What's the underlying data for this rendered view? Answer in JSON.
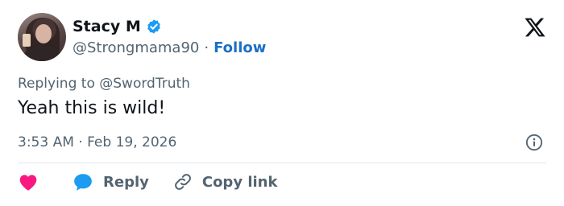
{
  "author": {
    "name": "Stacy M",
    "handle": "@Strongmama90",
    "separator": "·",
    "follow_label": "Follow"
  },
  "reply_context": {
    "text": "Replying to @SwordTruth"
  },
  "tweet": {
    "text": "Yeah this is wild!",
    "timestamp": "3:53 AM · Feb 19, 2026"
  },
  "actions": {
    "reply_label": "Reply",
    "copy_link_label": "Copy link"
  },
  "colors": {
    "like": "#f91880",
    "reply_bubble": "#1d9bf0",
    "verified": "#1d9bf0",
    "follow": "#1d6fc4",
    "muted": "#536471"
  },
  "icons": [
    "verified-badge-icon",
    "x-logo-icon",
    "info-icon",
    "heart-icon",
    "reply-bubble-icon",
    "link-icon"
  ]
}
